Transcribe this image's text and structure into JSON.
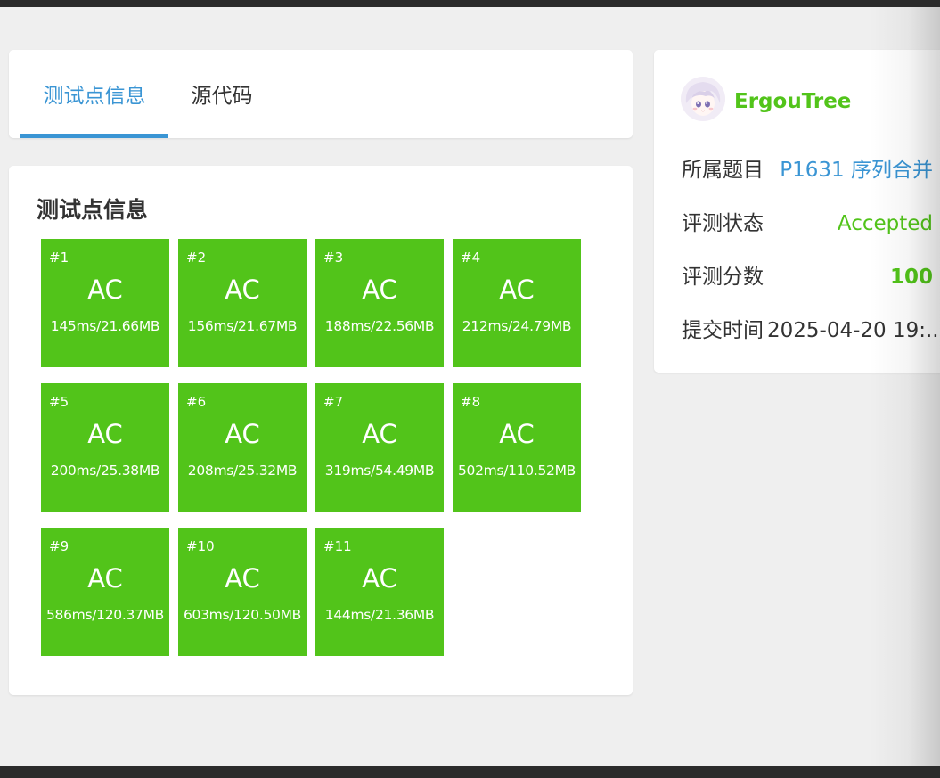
{
  "tabs": [
    {
      "label": "测试点信息",
      "active": true
    },
    {
      "label": "源代码",
      "active": false
    }
  ],
  "section": {
    "title": "测试点信息"
  },
  "colors": {
    "accent": "#3a95d4",
    "accepted": "#52c41a",
    "background": "#efefef"
  },
  "testcases": [
    {
      "num": "#1",
      "status": "AC",
      "meta": "145ms/21.66MB"
    },
    {
      "num": "#2",
      "status": "AC",
      "meta": "156ms/21.67MB"
    },
    {
      "num": "#3",
      "status": "AC",
      "meta": "188ms/22.56MB"
    },
    {
      "num": "#4",
      "status": "AC",
      "meta": "212ms/24.79MB"
    },
    {
      "num": "#5",
      "status": "AC",
      "meta": "200ms/25.38MB"
    },
    {
      "num": "#6",
      "status": "AC",
      "meta": "208ms/25.32MB"
    },
    {
      "num": "#7",
      "status": "AC",
      "meta": "319ms/54.49MB"
    },
    {
      "num": "#8",
      "status": "AC",
      "meta": "502ms/110.52MB"
    },
    {
      "num": "#9",
      "status": "AC",
      "meta": "586ms/120.37MB"
    },
    {
      "num": "#10",
      "status": "AC",
      "meta": "603ms/120.50MB"
    },
    {
      "num": "#11",
      "status": "AC",
      "meta": "144ms/21.36MB"
    }
  ],
  "user": {
    "name": "ErgouTree",
    "avatar_icon": "avatar-anime-girl"
  },
  "info": {
    "problem_label": "所属题目",
    "problem_value": "P1631 序列合并",
    "status_label": "评测状态",
    "status_value": "Accepted",
    "score_label": "评测分数",
    "score_value": "100",
    "time_label": "提交时间",
    "time_value": "2025-04-20 19:..."
  }
}
